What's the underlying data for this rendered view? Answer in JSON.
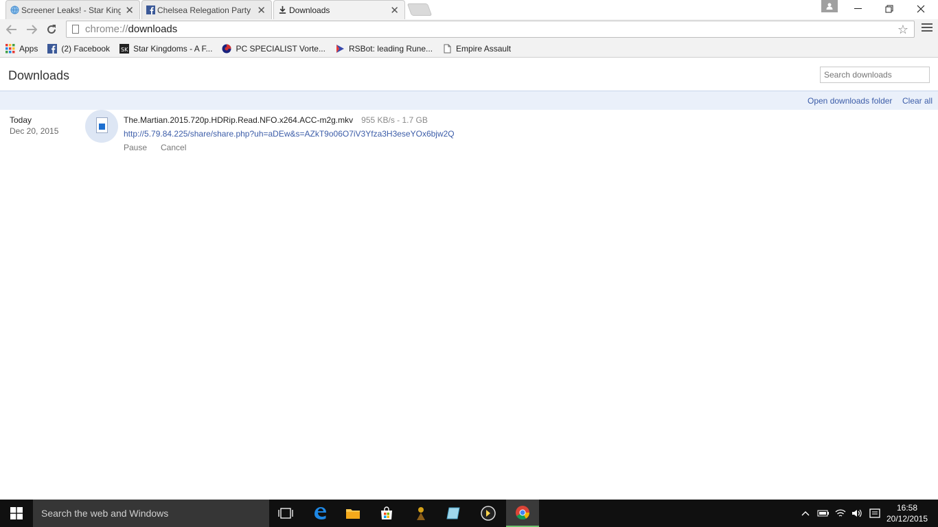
{
  "tabs": [
    {
      "label": "Screener Leaks! - Star King",
      "icon": "globe-icon"
    },
    {
      "label": "Chelsea Relegation Party",
      "icon": "facebook-icon"
    },
    {
      "label": "Downloads",
      "icon": "download-icon"
    }
  ],
  "address_bar": {
    "scheme": "chrome://",
    "path": "downloads"
  },
  "bookmarks": [
    {
      "label": "Apps",
      "icon": "apps-grid-icon"
    },
    {
      "label": "(2) Facebook",
      "icon": "facebook-icon"
    },
    {
      "label": "Star Kingdoms - A F...",
      "icon": "sk-icon"
    },
    {
      "label": "PC SPECIALIST Vorte...",
      "icon": "pc-specialist-icon"
    },
    {
      "label": "RSBot: leading Rune...",
      "icon": "rsbot-icon"
    },
    {
      "label": "Empire Assault",
      "icon": "page-icon"
    }
  ],
  "page": {
    "title": "Downloads",
    "search_placeholder": "Search downloads",
    "open_folder": "Open downloads folder",
    "clear_all": "Clear all"
  },
  "download": {
    "date_label": "Today",
    "date": "Dec 20, 2015",
    "filename": "The.Martian.2015.720p.HDRip.Read.NFO.x264.ACC-m2g.mkv",
    "status": "955 KB/s - 1.7 GB",
    "url": "http://5.79.84.225/share/share.php?uh=aDEw&s=AZkT9o06O7iV3Yfza3H3eseYOx6bjw2Q",
    "pause": "Pause",
    "cancel": "Cancel"
  },
  "taskbar": {
    "search_placeholder": "Search the web and Windows",
    "time": "16:58",
    "date": "20/12/2015"
  },
  "colors": {
    "link": "#3b5ca8",
    "action_bar": "#eaf0fa",
    "taskbar": "#101010"
  }
}
